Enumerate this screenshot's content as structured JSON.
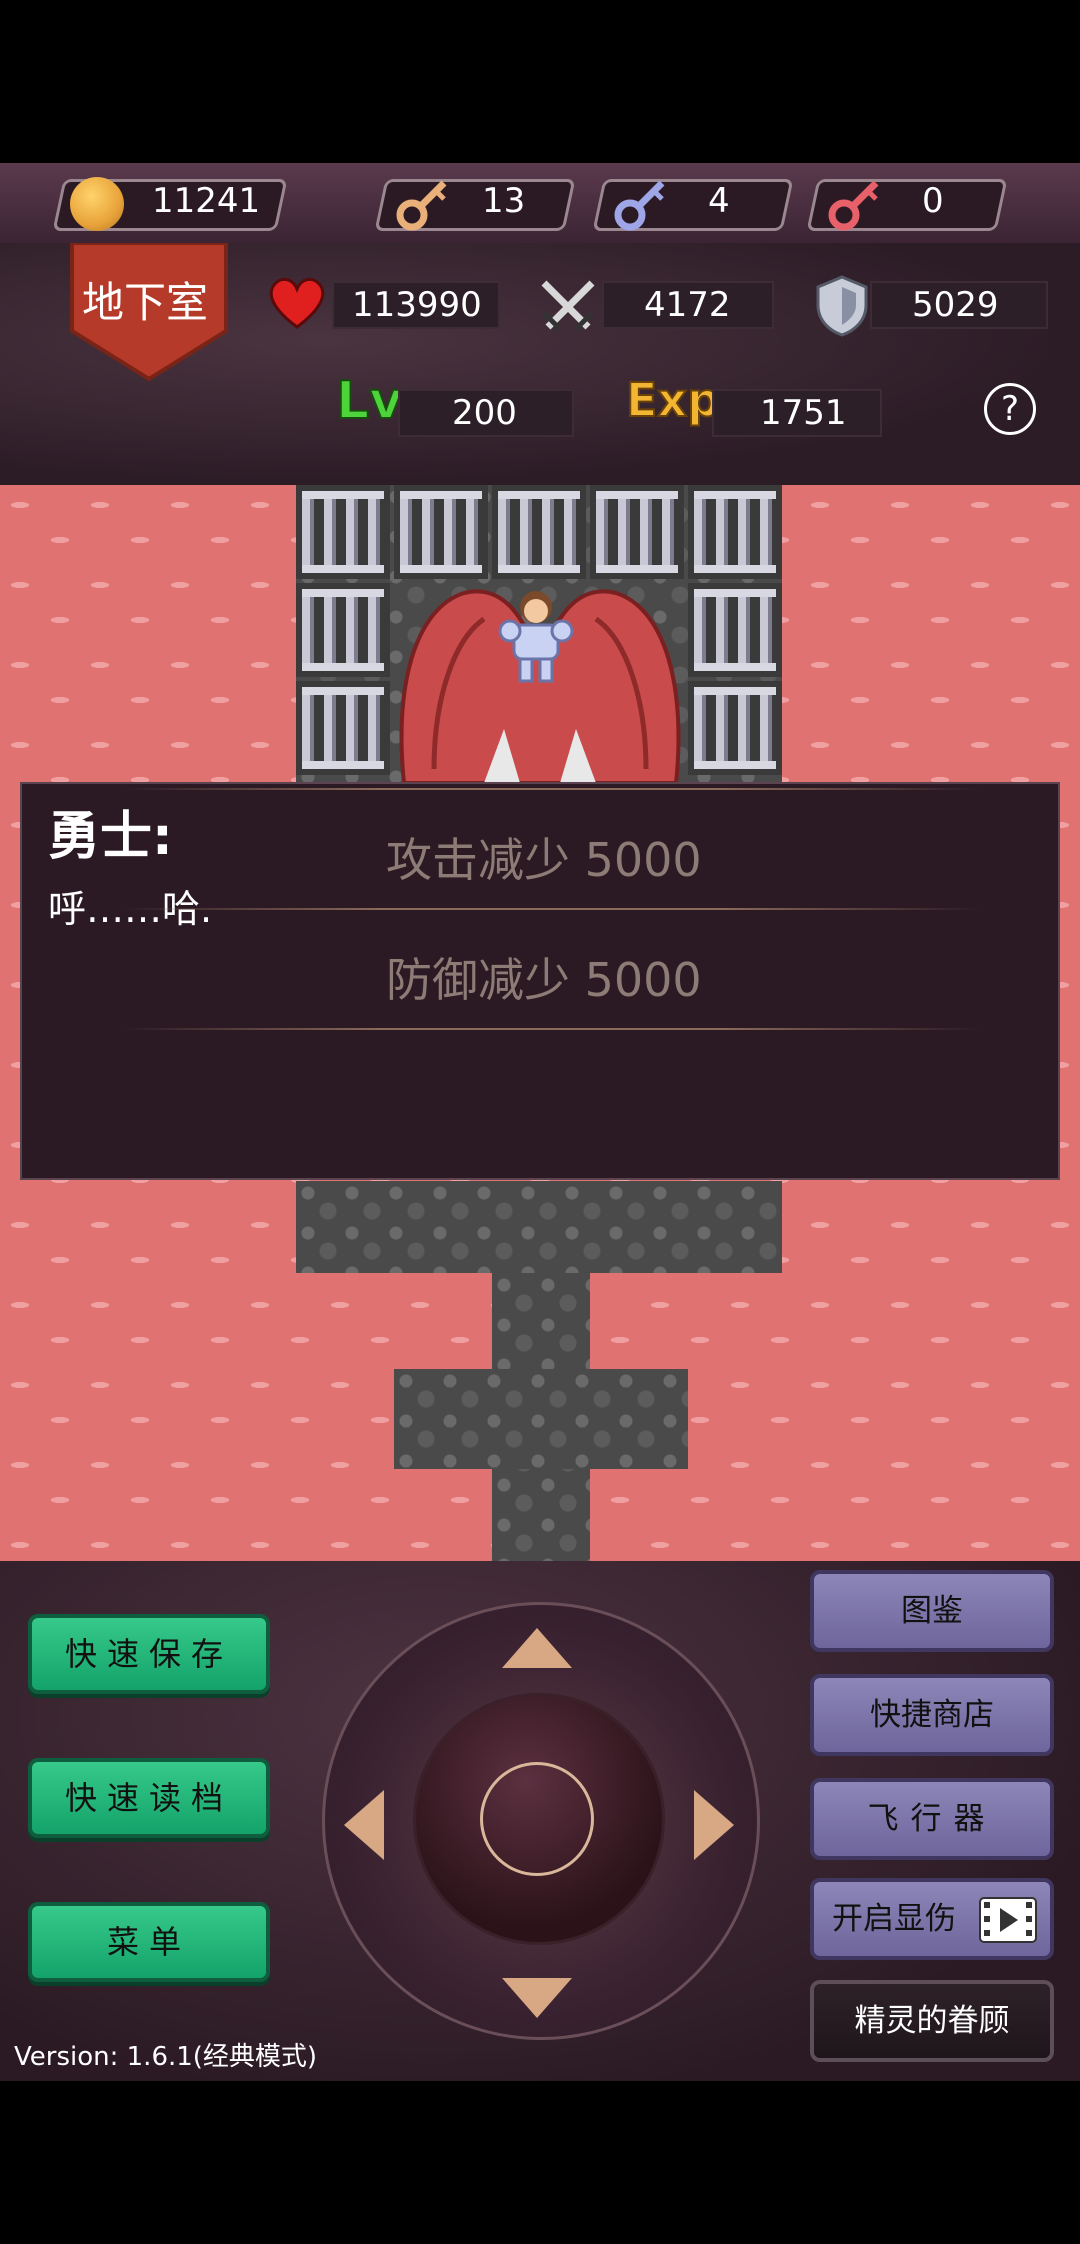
{
  "resources": {
    "gold": "11241",
    "yellow_keys": "13",
    "blue_keys": "4",
    "red_keys": "0"
  },
  "floor_label": "地下室",
  "stats": {
    "hp": "113990",
    "attack": "4172",
    "defense": "5029",
    "level_label": "Lv",
    "level": "200",
    "exp_label": "Exp",
    "exp": "1751",
    "help": "?"
  },
  "dialog": {
    "speaker": "勇士:",
    "text": "呼……哈.",
    "notice1": "攻击减少 5000",
    "notice2": "防御减少 5000"
  },
  "controls": {
    "quick_save": "快速保存",
    "quick_load": "快速读档",
    "menu": "菜单",
    "bestiary": "图鉴",
    "quick_shop": "快捷商店",
    "fly": "飞行器",
    "show_damage": "开启显伤",
    "spirit_blessing": "精灵的眷顾",
    "version": "Version: 1.6.1(经典模式)"
  },
  "colors": {
    "gold": "#e8a33a",
    "yellow_key": "#e9b07a",
    "blue_key": "#9fa6e8",
    "red_key": "#e8606a",
    "lava": "#e07272",
    "green_button": "#1fae74",
    "purple_button": "#7e77ad"
  }
}
